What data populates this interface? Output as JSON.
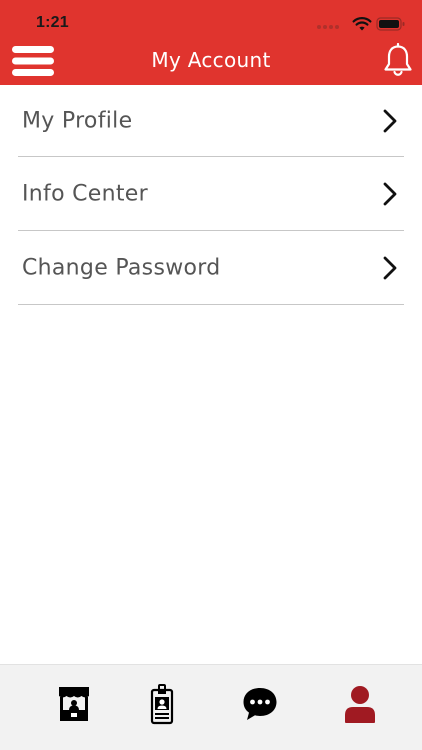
{
  "status_bar": {
    "time": "1:21",
    "icons": [
      "signal-icon",
      "wifi-icon",
      "battery-icon"
    ]
  },
  "header": {
    "title": "My Account",
    "left_icon": "hamburger-menu-icon",
    "right_icon": "bell-icon",
    "background_color": "#e0342e"
  },
  "menu": {
    "items": [
      {
        "label": "My Profile"
      },
      {
        "label": "Info Center"
      },
      {
        "label": "Change Password"
      }
    ]
  },
  "tabbar": {
    "tabs": [
      {
        "icon": "store-icon",
        "active": false
      },
      {
        "icon": "id-badge-icon",
        "active": false
      },
      {
        "icon": "chat-icon",
        "active": false
      },
      {
        "icon": "user-icon",
        "active": true
      }
    ],
    "active_color": "#a01a22",
    "inactive_color": "#000000"
  }
}
